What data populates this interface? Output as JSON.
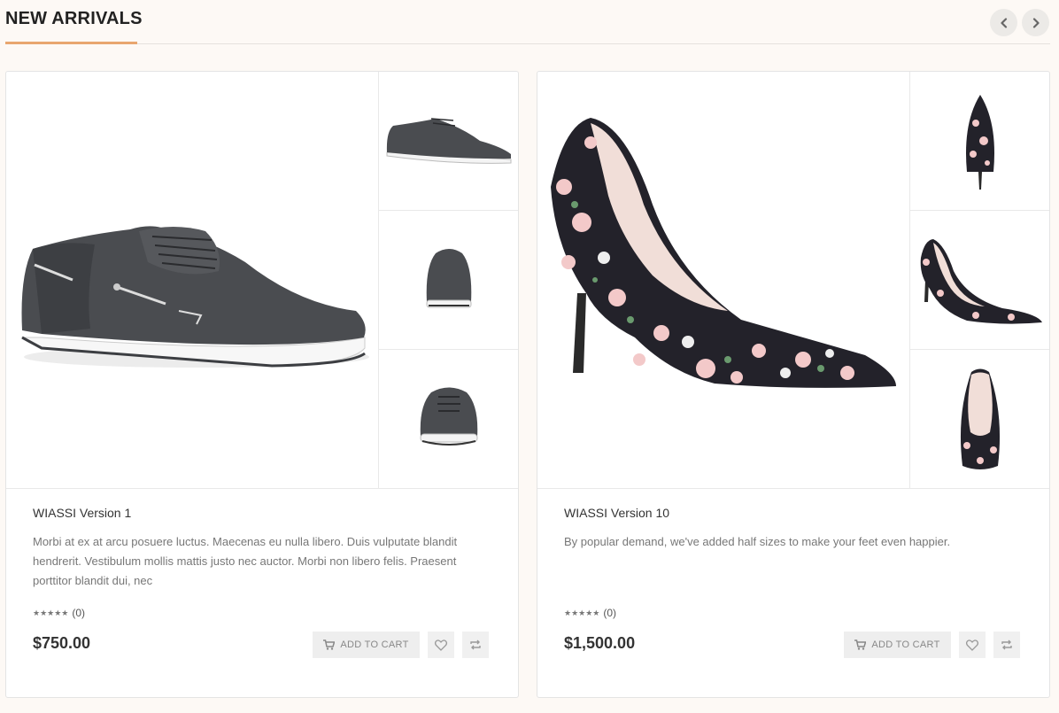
{
  "section": {
    "title": "NEW ARRIVALS"
  },
  "products": [
    {
      "name": "WIASSI Version 1",
      "description": "Morbi at ex at arcu posuere luctus. Maecenas eu nulla libero. Duis vulputate blandit hendrerit. Vestibulum mollis mattis justo nec auctor. Morbi non libero felis. Praesent porttitor blandit dui, nec",
      "rating_count": "(0)",
      "price": "$750.00",
      "add_to_cart": "ADD TO CART"
    },
    {
      "name": "WIASSI Version 10",
      "description": "By popular demand, we've added half sizes to make your feet even happier.",
      "rating_count": "(0)",
      "price": "$1,500.00",
      "add_to_cart": "ADD TO CART"
    }
  ],
  "icons": {
    "prev": "chevron-left-icon",
    "next": "chevron-right-icon",
    "cart": "cart-icon",
    "wishlist": "heart-icon",
    "compare": "compare-icon",
    "rating": "star-icon"
  },
  "colors": {
    "accent": "#e8a66f",
    "background": "#fdf9f5",
    "shoe_gray": "#4a4c50"
  }
}
